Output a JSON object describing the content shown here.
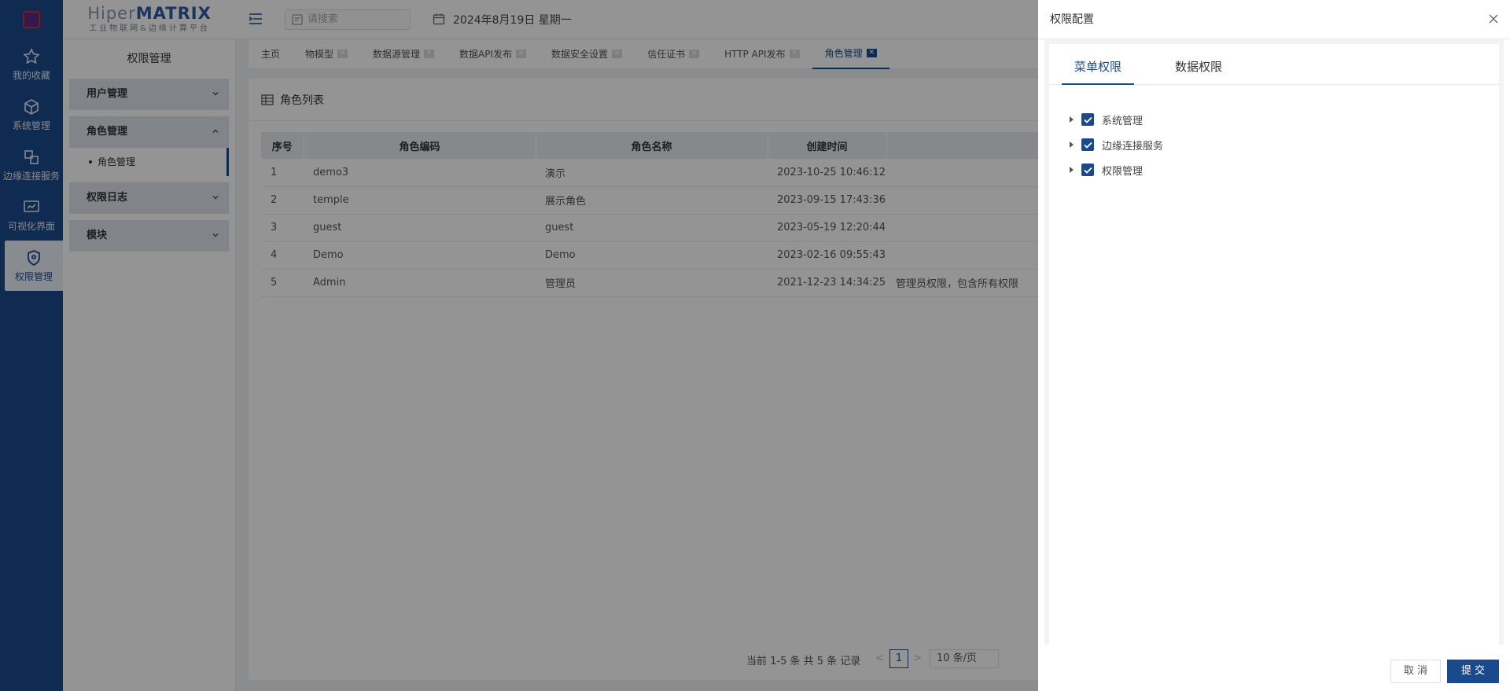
{
  "brand": {
    "name_prefix": "Hiper",
    "name_suffix": "MATRIX",
    "subtitle": "工业物联网&边缘计算平台"
  },
  "rail": {
    "items": [
      {
        "label": "我的收藏",
        "icon": "star-icon"
      },
      {
        "label": "系统管理",
        "icon": "cube-icon"
      },
      {
        "label": "边缘连接服务",
        "icon": "connect-icon"
      },
      {
        "label": "可视化界面",
        "icon": "chart-screen-icon"
      },
      {
        "label": "权限管理",
        "icon": "shield-icon"
      }
    ]
  },
  "header": {
    "search_placeholder": "请搜索",
    "date": "2024年8月19日 星期一"
  },
  "sidebar": {
    "title": "权限管理",
    "groups": [
      {
        "label": "用户管理"
      },
      {
        "label": "角色管理"
      },
      {
        "label": "权限日志"
      },
      {
        "label": "模块"
      }
    ],
    "sub_item": "角色管理"
  },
  "tabs": [
    {
      "label": "主页"
    },
    {
      "label": "物模型"
    },
    {
      "label": "数据源管理"
    },
    {
      "label": "数据API发布"
    },
    {
      "label": "数据安全设置"
    },
    {
      "label": "信任证书"
    },
    {
      "label": "HTTP API发布"
    },
    {
      "label": "角色管理"
    }
  ],
  "panel": {
    "title": "角色列表",
    "columns": [
      "序号",
      "角色编码",
      "角色名称",
      "创建时间"
    ],
    "rows": [
      {
        "no": "1",
        "code": "demo3",
        "name": "演示",
        "created": "2023-10-25 10:46:12",
        "desc": ""
      },
      {
        "no": "2",
        "code": "temple",
        "name": "展示角色",
        "created": "2023-09-15 17:43:36",
        "desc": ""
      },
      {
        "no": "3",
        "code": "guest",
        "name": "guest",
        "created": "2023-05-19 12:20:44",
        "desc": ""
      },
      {
        "no": "4",
        "code": "Demo",
        "name": "Demo",
        "created": "2023-02-16 09:55:43",
        "desc": ""
      },
      {
        "no": "5",
        "code": "Admin",
        "name": "管理员",
        "created": "2021-12-23 14:34:25",
        "desc": "管理员权限，包含所有权限"
      }
    ],
    "pager": {
      "info": "当前 1-5 条 共 5 条 记录",
      "page": "1",
      "size": "10 条/页"
    }
  },
  "drawer": {
    "title": "权限配置",
    "tabs": [
      "菜单权限",
      "数据权限"
    ],
    "tree": [
      {
        "label": "系统管理",
        "checked": true
      },
      {
        "label": "边缘连接服务",
        "checked": true
      },
      {
        "label": "权限管理",
        "checked": true
      }
    ],
    "cancel": "取 消",
    "submit": "提 交"
  },
  "colors": {
    "primary": "#1b4a8c",
    "rail_bg": "#1b4a8c",
    "mask": "rgba(0,0,0,0.42)"
  }
}
